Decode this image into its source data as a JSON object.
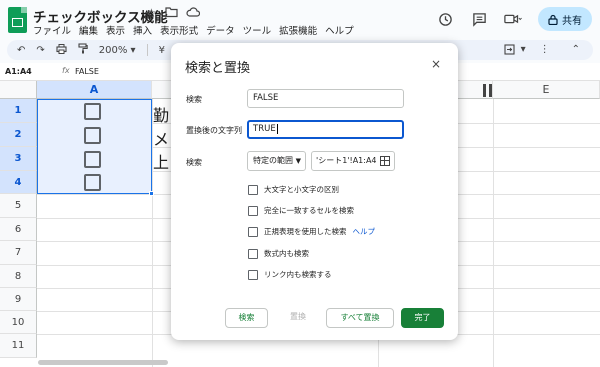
{
  "app": {
    "title": "チェックボックス機能",
    "menu": [
      "ファイル",
      "編集",
      "表示",
      "挿入",
      "表示形式",
      "データ",
      "ツール",
      "拡張機能",
      "ヘルプ"
    ],
    "share_label": "共有"
  },
  "toolbar": {
    "zoom": "200%",
    "currency": "¥",
    "percent": "%"
  },
  "formula_bar": {
    "name_box": "A1:A4",
    "fx": "fx",
    "value": "FALSE"
  },
  "sheet": {
    "columns": [
      "A",
      "E"
    ],
    "rows": [
      "1",
      "2",
      "3",
      "4",
      "5",
      "6",
      "7",
      "8",
      "9",
      "10",
      "11"
    ],
    "cell_texts": [
      "勤",
      "メ",
      "上"
    ]
  },
  "dialog": {
    "title": "検索と置換",
    "close": "×",
    "search_label": "検索",
    "search_value": "FALSE",
    "replace_label": "置換後の文字列",
    "replace_value": "TRUE",
    "scope_label": "検索",
    "scope_value": "特定の範囲",
    "range_value": "'シート1'!A1:A4",
    "options": [
      "大文字と小文字の区別",
      "完全に一致するセルを検索",
      "正規表現を使用した検索",
      "数式内も検索",
      "リンク内も検索する"
    ],
    "help_link": "ヘルプ",
    "buttons": {
      "find": "検索",
      "replace": "置換",
      "replace_all": "すべて置換",
      "done": "完了"
    }
  },
  "colors": {
    "accent": "#0b57d0",
    "done_button": "#188038",
    "selection_fill": "#e8f0fe",
    "share_button": "#c2e7ff"
  }
}
